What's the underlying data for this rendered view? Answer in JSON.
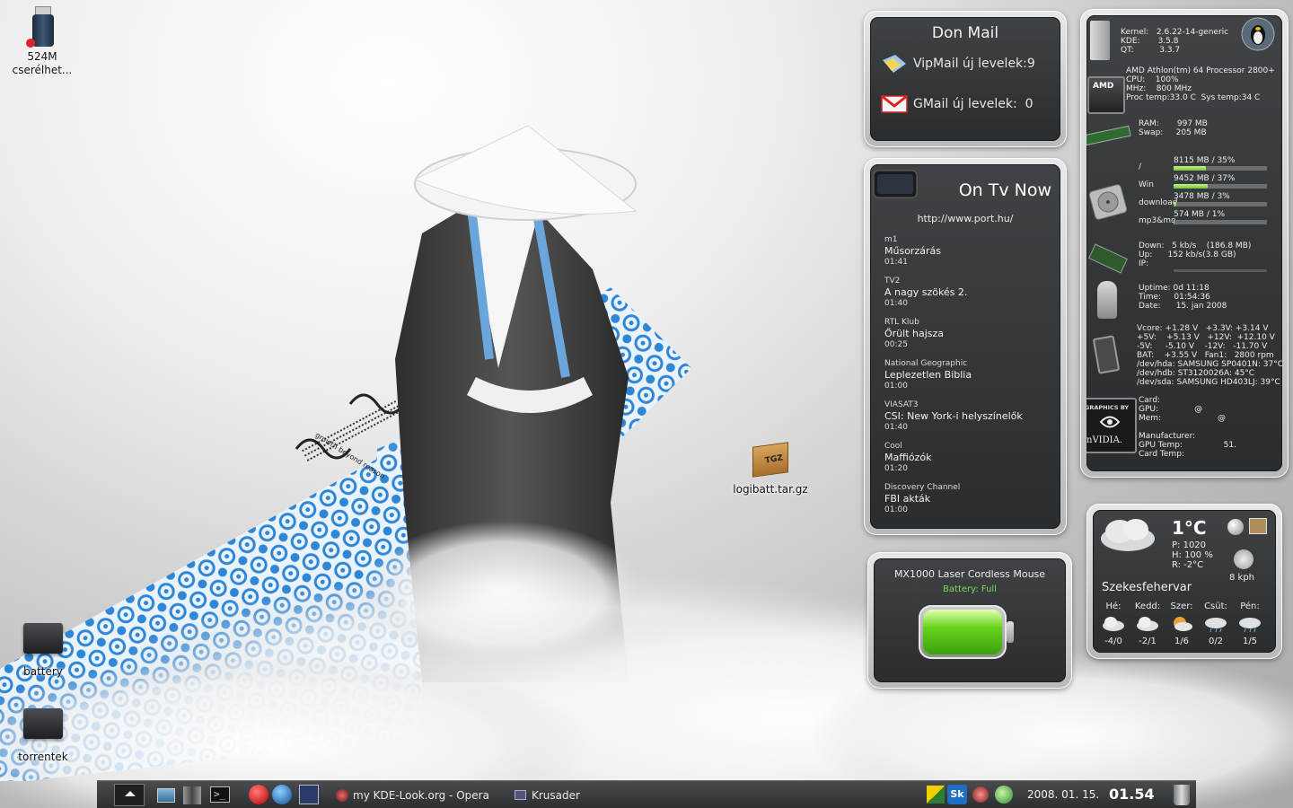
{
  "desktop": {
    "icons": [
      {
        "label": "524M cserélhet..."
      },
      {
        "label": "logibatt.tar.gz"
      },
      {
        "label": "battery"
      },
      {
        "label": "torrentek"
      }
    ],
    "wallpaper_text": "growth beyond reason"
  },
  "mail_widget": {
    "title": "Don Mail",
    "vipmail": "VipMail új levelek:9",
    "gmail": "GMail új levelek:  0"
  },
  "tv_widget": {
    "title": "On Tv Now",
    "url": "http://www.port.hu/",
    "items": [
      {
        "channel": "m1",
        "show": "Műsorzárás",
        "time": "01:41"
      },
      {
        "channel": "TV2",
        "show": "A nagy szökés 2.",
        "time": "01:40"
      },
      {
        "channel": "RTL Klub",
        "show": "Őrült hajsza",
        "time": "00:25"
      },
      {
        "channel": "National Geographic",
        "show": "Leplezetlen Biblia",
        "time": "01:00"
      },
      {
        "channel": "VIASAT3",
        "show": "CSI: New York-i helyszínelők",
        "time": "01:40"
      },
      {
        "channel": "Cool",
        "show": "Maffiózók",
        "time": "01:20"
      },
      {
        "channel": "Discovery Channel",
        "show": "FBI akták",
        "time": "01:00"
      }
    ]
  },
  "mouse_widget": {
    "title": "MX1000 Laser Cordless Mouse",
    "battery": "Battery: Full",
    "battery_level": 1.0
  },
  "sysmon": {
    "kernel": "Kernel:   2.6.22-14-generic\nKDE:       3.5.8\nQT:          3.3.7",
    "cpu": "AMD Athlon(tm) 64 Processor 2800+\nCPU:    100%\nMHz:    800 MHz\nProc temp:33.0 C  Sys temp:34 C",
    "ram": "RAM:       997 MB\nSwap:     205 MB",
    "disks": [
      {
        "name": "/",
        "value": "8115 MB / 35%",
        "percent": 35
      },
      {
        "name": "Win",
        "value": "9452 MB / 37%",
        "percent": 37
      },
      {
        "name": "download",
        "value": "3478 MB / 3%",
        "percent": 3
      },
      {
        "name": "mp3&mo",
        "value": "574 MB / 1%",
        "percent": 1
      }
    ],
    "net": "Down:   5 kb/s    (186.8 MB)\nUp:      152 kb/s(3.8 GB)\nIP:",
    "time": "Uptime: 0d 11:18\nTime:     01:54:36\nDate:      15. jan 2008",
    "sensors": "Vcore: +1.28 V   +3.3V: +3.14 V\n+5V:    +5.13 V   +12V:  +12.10 V\n-5V:     -5.10 V    -12V:   -11.70 V\nBAT:    +3.55 V   Fan1:   2800 rpm\n/dev/hda: SAMSUNG SP0401N: 37°C\n/dev/hdb: ST3120026A: 45°C\n/dev/sda: SAMSUNG HD403LJ: 39°C",
    "gpu": "Card:\nGPU:              @\nMem:                      @",
    "gpu2": "Manufacturer:\nGPU Temp:                51.\nCard Temp:",
    "nvidia_badge": "GRAPHICS BY",
    "nvidia_logo": "nVIDIA.",
    "amd_logo": "AMD"
  },
  "weather": {
    "temp": "1°C",
    "details": "P: 1020\nH: 100 %\nR: -2°C",
    "wind": "8 kph",
    "city": "Szekesfehervar",
    "days": [
      {
        "name": "Hé:",
        "range": "-4/0"
      },
      {
        "name": "Kedd:",
        "range": "-2/1"
      },
      {
        "name": "Szer:",
        "range": "1/6"
      },
      {
        "name": "Csüt:",
        "range": "0/2"
      },
      {
        "name": "Pén:",
        "range": "1/5"
      }
    ]
  },
  "taskbar": {
    "tasks": [
      {
        "label": "my KDE-Look.org - Opera"
      },
      {
        "label": "Krusader"
      }
    ],
    "tray_sk": "Sk",
    "date": "2008. 01. 15.",
    "time": "01.54"
  },
  "colors": {
    "panel_bg": "#2f3235",
    "battery_green": "#7fd85a",
    "bar_green": "#8fd85a",
    "pattern_blue": "#3a8fd8"
  }
}
